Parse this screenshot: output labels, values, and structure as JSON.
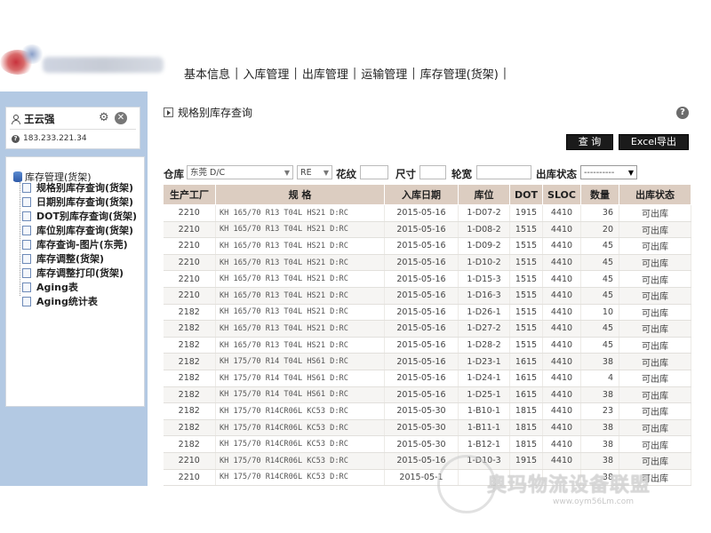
{
  "nav": {
    "items": [
      "基本信息",
      "入库管理",
      "出库管理",
      "运输管理",
      "库存管理(货架)"
    ],
    "separator": "|"
  },
  "user": {
    "name": "王云强",
    "ip": "183.233.221.34"
  },
  "tree": {
    "root": "库存管理(货架)",
    "items": [
      "规格别库存查询(货架)",
      "日期别库存查询(货架)",
      "DOT别库存查询(货架)",
      "库位别库存查询(货架)",
      "库存查询-图片(东莞)",
      "库存调整(货架)",
      "库存调整打印(货架)",
      "Aging表",
      "Aging统计表"
    ]
  },
  "page": {
    "title": "规格别库存查询",
    "help": "?"
  },
  "toolbar": {
    "query_label": "查 询",
    "excel_label": "Excel导出"
  },
  "filters": {
    "warehouse_label": "仓库",
    "warehouse_value": "东莞  D/C",
    "type_value": "RE",
    "pattern_label": "花纹",
    "size_label": "尺寸",
    "width_label": "轮宽",
    "status_label": "出库状态",
    "status_value": "----------"
  },
  "table": {
    "headers": [
      "生产工厂",
      "规 格",
      "入库日期",
      "库位",
      "DOT",
      "SLOC",
      "数量",
      "出库状态"
    ],
    "rows": [
      [
        "2210",
        "KH 165/70  R13 T04L HS21  D:RC",
        "2015-05-16",
        "1-D07-2",
        "1915",
        "4410",
        "36",
        "可出库"
      ],
      [
        "2210",
        "KH 165/70  R13 T04L HS21  D:RC",
        "2015-05-16",
        "1-D08-2",
        "1515",
        "4410",
        "20",
        "可出库"
      ],
      [
        "2210",
        "KH 165/70  R13 T04L HS21  D:RC",
        "2015-05-16",
        "1-D09-2",
        "1515",
        "4410",
        "45",
        "可出库"
      ],
      [
        "2210",
        "KH 165/70  R13 T04L HS21  D:RC",
        "2015-05-16",
        "1-D10-2",
        "1515",
        "4410",
        "45",
        "可出库"
      ],
      [
        "2210",
        "KH 165/70  R13 T04L HS21  D:RC",
        "2015-05-16",
        "1-D15-3",
        "1515",
        "4410",
        "45",
        "可出库"
      ],
      [
        "2210",
        "KH 165/70  R13 T04L HS21  D:RC",
        "2015-05-16",
        "1-D16-3",
        "1515",
        "4410",
        "45",
        "可出库"
      ],
      [
        "2182",
        "KH 165/70  R13 T04L HS21  D:RC",
        "2015-05-16",
        "1-D26-1",
        "1515",
        "4410",
        "10",
        "可出库"
      ],
      [
        "2182",
        "KH 165/70  R13 T04L HS21  D:RC",
        "2015-05-16",
        "1-D27-2",
        "1515",
        "4410",
        "45",
        "可出库"
      ],
      [
        "2182",
        "KH 165/70  R13 T04L HS21  D:RC",
        "2015-05-16",
        "1-D28-2",
        "1515",
        "4410",
        "45",
        "可出库"
      ],
      [
        "2182",
        "KH 175/70  R14 T04L HS61  D:RC",
        "2015-05-16",
        "1-D23-1",
        "1615",
        "4410",
        "38",
        "可出库"
      ],
      [
        "2182",
        "KH 175/70  R14 T04L HS61  D:RC",
        "2015-05-16",
        "1-D24-1",
        "1615",
        "4410",
        "4",
        "可出库"
      ],
      [
        "2182",
        "KH 175/70  R14 T04L HS61  D:RC",
        "2015-05-16",
        "1-D25-1",
        "1615",
        "4410",
        "38",
        "可出库"
      ],
      [
        "2182",
        "KH 175/70  R14CR06L KC53  D:RC",
        "2015-05-30",
        "1-B10-1",
        "1815",
        "4410",
        "23",
        "可出库"
      ],
      [
        "2182",
        "KH 175/70  R14CR06L KC53  D:RC",
        "2015-05-30",
        "1-B11-1",
        "1815",
        "4410",
        "38",
        "可出库"
      ],
      [
        "2182",
        "KH 175/70  R14CR06L KC53  D:RC",
        "2015-05-30",
        "1-B12-1",
        "1815",
        "4410",
        "38",
        "可出库"
      ],
      [
        "2210",
        "KH 175/70  R14CR06L KC53  D:RC",
        "2015-05-16",
        "1-D10-3",
        "1915",
        "4410",
        "38",
        "可出库"
      ],
      [
        "2210",
        "KH 175/70  R14CR06L KC53  D:RC",
        "2015-05-1",
        "",
        "",
        "",
        "38",
        "可出库"
      ]
    ]
  },
  "watermark": {
    "text": "奥玛物流设备联盟",
    "url": "www.oym56Lm.com"
  },
  "colors": {
    "sidebar_bg": "#b3c9e3",
    "table_header_bg": "#dccdc1",
    "button_bg": "#1b1b1b"
  }
}
